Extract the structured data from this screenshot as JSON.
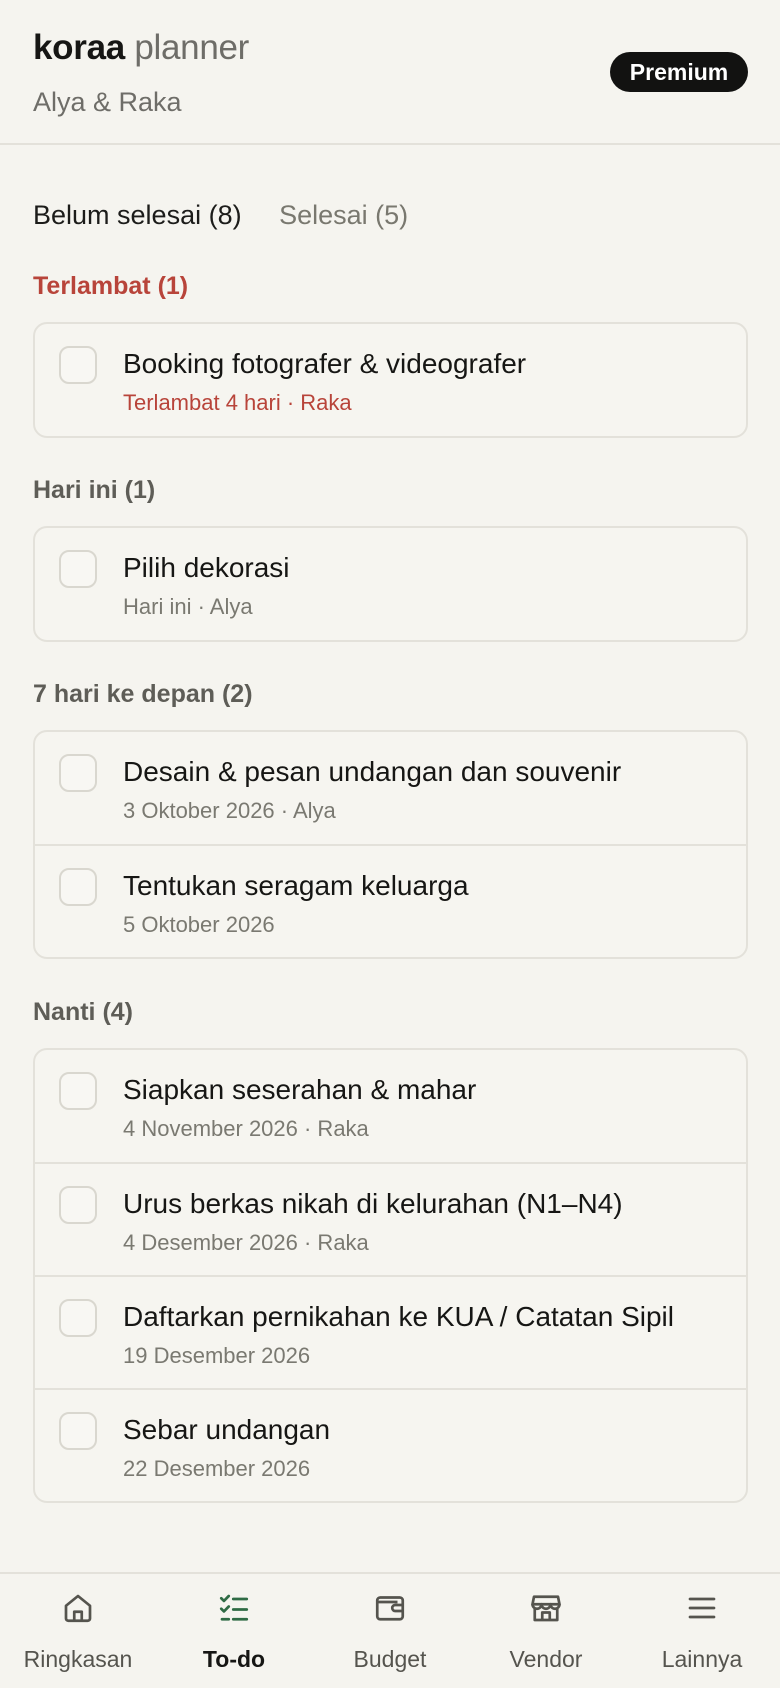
{
  "header": {
    "brand_bold": "koraa",
    "brand_light": "planner",
    "couple": "Alya & Raka",
    "badge": "Premium"
  },
  "tabs": [
    {
      "label": "Belum selesai (8)",
      "active": true
    },
    {
      "label": "Selesai (5)",
      "active": false
    }
  ],
  "sections": {
    "late": {
      "title": "Terlambat (1)",
      "items": [
        {
          "title": "Booking fotografer & videografer",
          "meta": "Terlambat 4 hari · Raka"
        }
      ]
    },
    "today": {
      "title": "Hari ini (1)",
      "items": [
        {
          "title": "Pilih dekorasi",
          "meta": "Hari ini · Alya"
        }
      ]
    },
    "week": {
      "title": "7 hari ke depan (2)",
      "items": [
        {
          "title": "Desain & pesan undangan dan souvenir",
          "meta": "3 Oktober 2026 · Alya"
        },
        {
          "title": "Tentukan seragam keluarga",
          "meta": "5 Oktober 2026"
        }
      ]
    },
    "later": {
      "title": "Nanti (4)",
      "items": [
        {
          "title": "Siapkan seserahan & mahar",
          "meta": "4 November 2026 · Raka"
        },
        {
          "title": "Urus berkas nikah di kelurahan (N1–N4)",
          "meta": "4 Desember 2026 · Raka"
        },
        {
          "title": "Daftarkan pernikahan ke KUA / Catatan Sipil",
          "meta": "19 Desember 2026"
        },
        {
          "title": "Sebar undangan",
          "meta": "22 Desember 2026"
        }
      ]
    }
  },
  "nav": [
    {
      "label": "Ringkasan",
      "icon": "home-icon"
    },
    {
      "label": "To-do",
      "icon": "checklist-icon",
      "active": true
    },
    {
      "label": "Budget",
      "icon": "wallet-icon"
    },
    {
      "label": "Vendor",
      "icon": "store-icon"
    },
    {
      "label": "Lainnya",
      "icon": "menu-icon"
    }
  ],
  "colors": {
    "background": "#f5f4ef",
    "late": "#b8443a",
    "active_nav_icon": "#2f6b45",
    "badge_bg": "#121211"
  }
}
